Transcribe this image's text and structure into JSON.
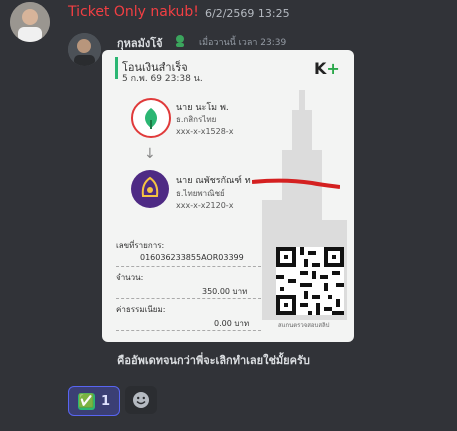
{
  "message1": {
    "username": "Ticket Only nakub!",
    "timestamp": "6/2/2569 13:25"
  },
  "message2": {
    "username": "กุหลมังโจ้",
    "timestamp": "เมื่อวานนี้ เวลา 23:39",
    "text": "คืออัพเดทจนกว่าพี่จะเลิกทำเลยใช่มั้ยครับ"
  },
  "receipt": {
    "title": "โอนเงินสำเร็จ",
    "datetime": "5 ก.พ. 69  23:38 น.",
    "brand": "K",
    "brand_plus": "+",
    "sender": {
      "name": "นาย นะโม พ.",
      "bank": "ธ.กสิกรไทย",
      "account": "xxx-x-x1528-x"
    },
    "arrow": "↓",
    "receiver": {
      "name": "นาย ณพัชรกัณฑ์ ท",
      "bank": "ธ.ไทยพาณิชย์",
      "account": "xxx-x-x2120-x"
    },
    "ref_label": "เลขที่รายการ:",
    "ref_value": "016036233855AOR03399",
    "amount_label": "จำนวน:",
    "amount_value": "350.00 บาท",
    "fee_label": "ค่าธรรมเนียม:",
    "fee_value": "0.00 บาท",
    "qr_caption": "สแกนตรวจสอบสลิป"
  },
  "reactions": [
    {
      "emoji": "✅",
      "count": "1"
    }
  ],
  "colors": {
    "background": "#313338",
    "username1": "#f23f43",
    "kbank_green": "#2bb673",
    "scb_purple": "#4e2a84",
    "reaction_bg": "#3b3f74"
  }
}
